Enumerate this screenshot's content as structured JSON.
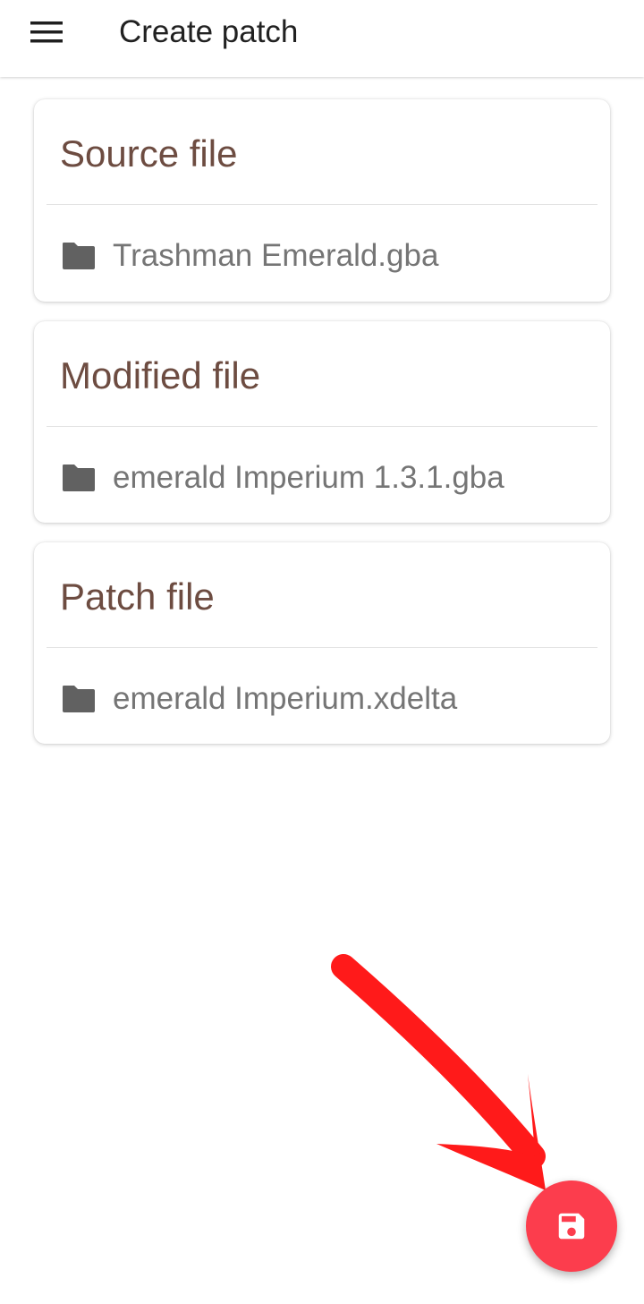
{
  "appbar": {
    "title": "Create patch",
    "menu_icon": "menu-icon"
  },
  "cards": [
    {
      "title": "Source file",
      "file_name": "Trashman Emerald.gba",
      "icon": "folder-icon"
    },
    {
      "title": "Modified file",
      "file_name": "emerald Imperium 1.3.1.gba",
      "icon": "folder-icon"
    },
    {
      "title": "Patch file",
      "file_name": "emerald Imperium.xdelta",
      "icon": "folder-icon"
    }
  ],
  "fab": {
    "icon": "save-icon",
    "color": "#fc3d4d"
  },
  "overlay": {
    "arrow_color": "#ff1a1a"
  },
  "colors": {
    "card_title": "#6d4c41",
    "file_text": "#757575",
    "icon": "#616161"
  }
}
